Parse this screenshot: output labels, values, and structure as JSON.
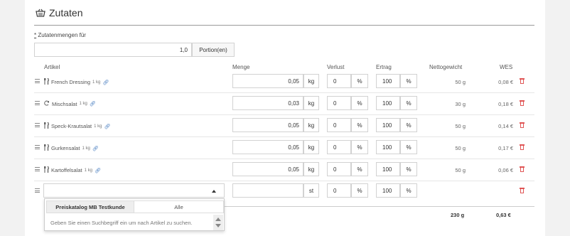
{
  "section": {
    "title": "Zutaten",
    "icon": "basket-icon"
  },
  "portion": {
    "label": "Zutatenmengen für",
    "required_mark": "*",
    "value": "1,0",
    "unit": "Portion(en)"
  },
  "columns": {
    "artikel": "Artikel",
    "menge": "Menge",
    "verlust": "Verlust",
    "ertrag": "Ertrag",
    "nettogewicht": "Nettogewicht",
    "wes": "WES"
  },
  "rows": [
    {
      "icon": "fork-knife-icon",
      "name": "French Dressing",
      "weight": "1 kg",
      "menge": "0,05",
      "unit": "kg",
      "verlust": "0",
      "verlust_unit": "%",
      "ertrag": "100",
      "ertrag_unit": "%",
      "netto": "50 g",
      "wes": "0,08 €"
    },
    {
      "icon": "refresh-icon",
      "name": "Mischsalat",
      "weight": "1 kg",
      "menge": "0,03",
      "unit": "kg",
      "verlust": "0",
      "verlust_unit": "%",
      "ertrag": "100",
      "ertrag_unit": "%",
      "netto": "30 g",
      "wes": "0,18 €"
    },
    {
      "icon": "fork-knife-icon",
      "name": "Speck-Krautsalat",
      "weight": "1 kg",
      "menge": "0,05",
      "unit": "kg",
      "verlust": "0",
      "verlust_unit": "%",
      "ertrag": "100",
      "ertrag_unit": "%",
      "netto": "50 g",
      "wes": "0,14 €"
    },
    {
      "icon": "fork-knife-icon",
      "name": "Gurkensalat",
      "weight": "1 kg",
      "menge": "0,05",
      "unit": "kg",
      "verlust": "0",
      "verlust_unit": "%",
      "ertrag": "100",
      "ertrag_unit": "%",
      "netto": "50 g",
      "wes": "0,17 €"
    },
    {
      "icon": "fork-knife-icon",
      "name": "Kartoffelsalat",
      "weight": "1 kg",
      "menge": "0,05",
      "unit": "kg",
      "verlust": "0",
      "verlust_unit": "%",
      "ertrag": "100",
      "ertrag_unit": "%",
      "netto": "50 g",
      "wes": "0,06 €"
    }
  ],
  "new_row": {
    "menge": "",
    "unit": "st",
    "verlust": "0",
    "verlust_unit": "%",
    "ertrag": "100",
    "ertrag_unit": "%"
  },
  "dropdown": {
    "tab_active": "Preiskatalog MB Testkunde",
    "tab_inactive": "Alle",
    "hint": "Geben Sie einen Suchbegriff ein um nach Artikel zu suchen."
  },
  "totals": {
    "netto": "230 g",
    "wes": "0,63 €"
  },
  "colors": {
    "accent": "#4a7fc1",
    "delete": "#e05555"
  }
}
